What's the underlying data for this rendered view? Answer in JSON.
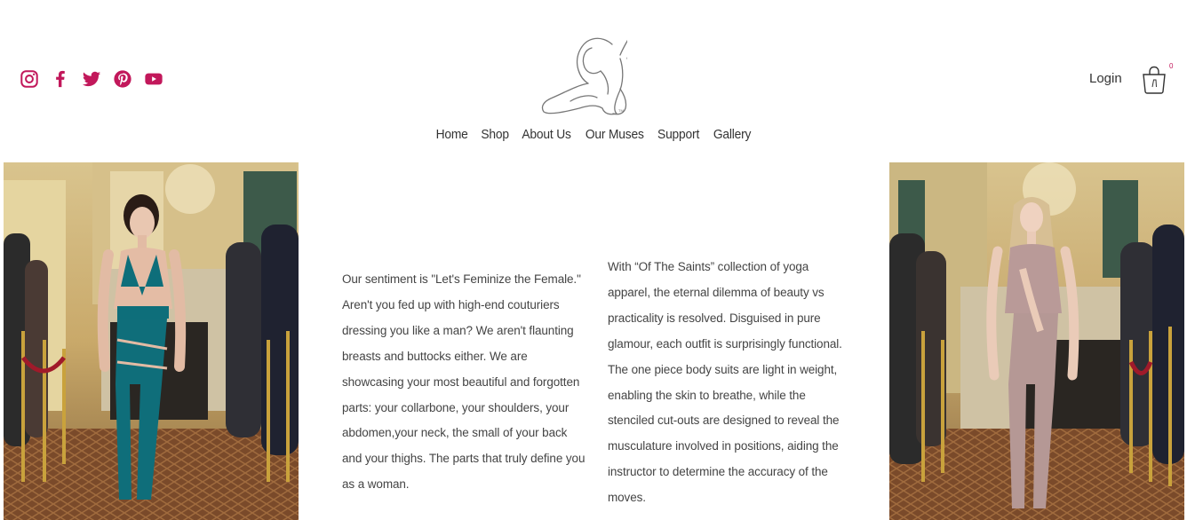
{
  "social": {
    "icons": [
      "instagram-icon",
      "facebook-icon",
      "twitter-icon",
      "pinterest-icon",
      "youtube-icon"
    ],
    "color": "#c2185b"
  },
  "logo": {
    "icon": "elephant-logo-icon",
    "mark": "TM"
  },
  "nav": {
    "items": [
      "Home",
      "Shop",
      "About Us",
      "Our Muses",
      "Support",
      "Gallery"
    ]
  },
  "account": {
    "login_label": "Login",
    "cart_count": "0"
  },
  "content": {
    "left_text": "Our sentiment is \"Let's Feminize the Female.\" Aren't you fed up with high-end couturiers dressing you like a man? We aren't flaunting breasts and buttocks either. We are showcasing your most beautiful and forgotten parts: your collarbone, your shoulders, your abdomen,your neck, the small of your back and your thighs. The parts that truly define you as a woman.",
    "right_text": "With “Of The Saints” collection of yoga apparel, the eternal dilemma of beauty vs practicality is resolved. Disguised in pure glamour, each outfit is surprisingly functional. The one piece body suits are light in weight, enabling the skin to breathe, while the stenciled cut-outs are designed to reveal the musculature involved in positions, aiding the instructor to determine the accuracy of the moves."
  }
}
